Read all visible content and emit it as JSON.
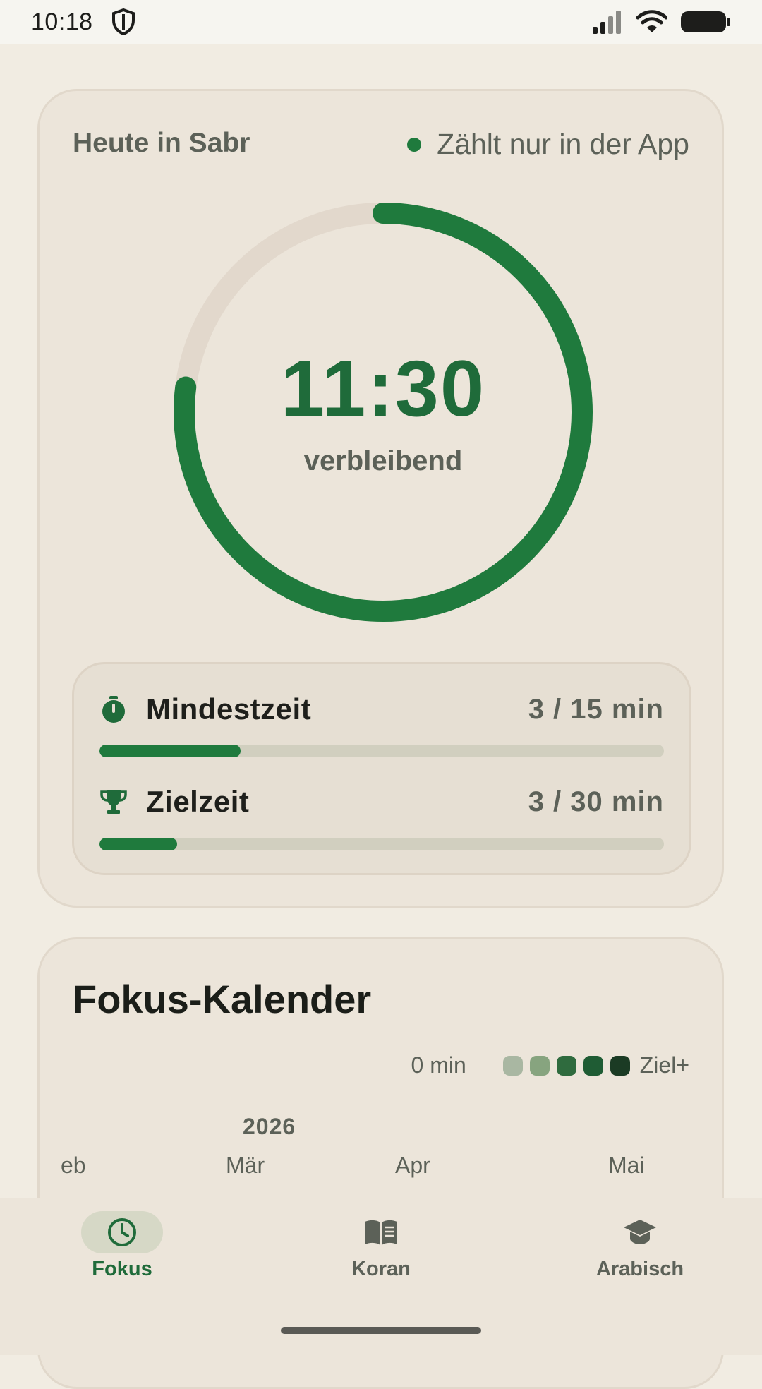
{
  "status": {
    "time": "10:18"
  },
  "today": {
    "title": "Heute in Sabr",
    "app_only_label": "Zählt nur in der App",
    "timer": "11:30",
    "timer_sub": "verbleibend",
    "ring_progress": 0.77
  },
  "progress": {
    "min": {
      "label": "Mindestzeit",
      "value": "3 / 15 min",
      "fraction": 0.25
    },
    "goal": {
      "label": "Zielzeit",
      "value": "3 / 30 min",
      "fraction": 0.137
    }
  },
  "calendar": {
    "title": "Fokus-Kalender",
    "legend_start": "0 min",
    "legend_end": "Ziel+",
    "legend_colors": [
      "#ece5da",
      "#a9b7a2",
      "#87a47f",
      "#2f6b3e",
      "#1f5c34",
      "#1b3b24"
    ],
    "year": "2026",
    "months": [
      "eb",
      "Mär",
      "Apr",
      "Mai"
    ]
  },
  "nav": {
    "items": [
      {
        "label": "Fokus",
        "icon": "clock-icon"
      },
      {
        "label": "Koran",
        "icon": "book-icon"
      },
      {
        "label": "Arabisch",
        "icon": "graduation-cap-icon"
      }
    ]
  },
  "colors": {
    "accent": "#1f7a3d",
    "background": "#f1ece2",
    "card": "#ece5da"
  }
}
